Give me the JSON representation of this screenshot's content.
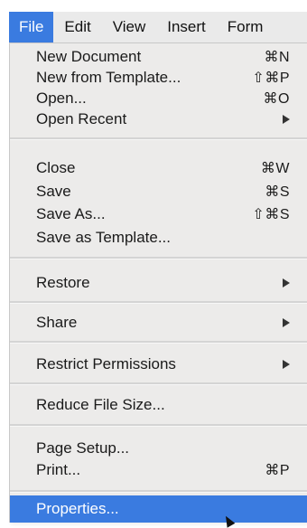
{
  "menubar": {
    "items": [
      "File",
      "Edit",
      "View",
      "Insert",
      "Form"
    ],
    "active_index": 0
  },
  "file_menu": {
    "group1": [
      {
        "label": "New Document",
        "shortcut": "⌘N"
      },
      {
        "label": "New from Template...",
        "shortcut": "⇧⌘P"
      },
      {
        "label": "Open...",
        "shortcut": "⌘O"
      },
      {
        "label": "Open Recent",
        "submenu": true
      }
    ],
    "group2": [
      {
        "label": "Close",
        "shortcut": "⌘W"
      },
      {
        "label": "Save",
        "shortcut": "⌘S"
      },
      {
        "label": "Save As...",
        "shortcut": "⇧⌘S"
      },
      {
        "label": "Save as Template..."
      }
    ],
    "restore": {
      "label": "Restore",
      "submenu": true
    },
    "share": {
      "label": "Share",
      "submenu": true
    },
    "restrict": {
      "label": "Restrict Permissions",
      "submenu": true
    },
    "reduce": {
      "label": "Reduce File Size..."
    },
    "group3": [
      {
        "label": "Page Setup..."
      },
      {
        "label": "Print...",
        "shortcut": "⌘P"
      }
    ],
    "properties": {
      "label": "Properties...",
      "highlighted": true
    }
  },
  "colors": {
    "highlight": "#3a7be0",
    "menu_bg": "#ecebea",
    "menubar_bg": "#eaeaea"
  }
}
